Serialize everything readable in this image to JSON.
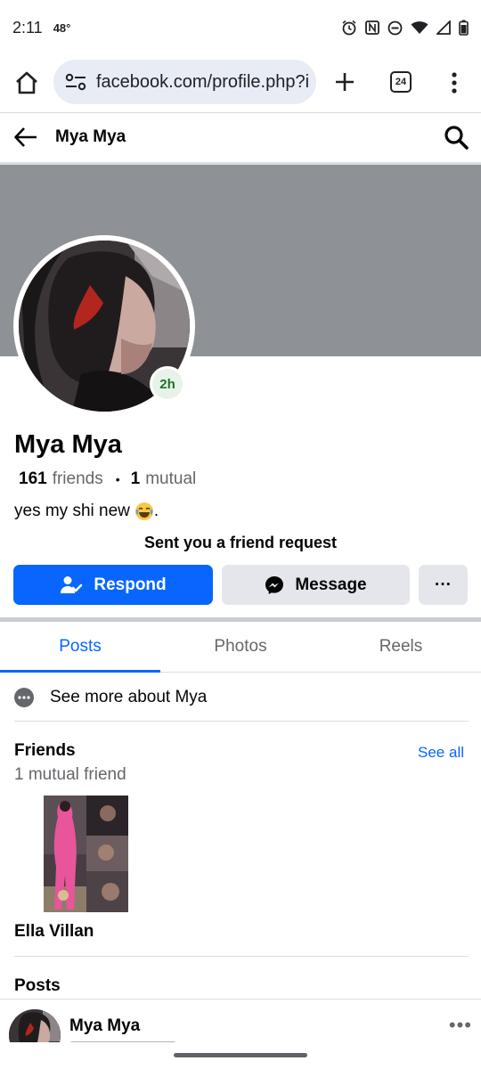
{
  "status_bar": {
    "time": "2:11",
    "temperature": "48°"
  },
  "browser": {
    "url": "facebook.com/profile.php?i",
    "tab_count": "24"
  },
  "header": {
    "title": "Mya Mya"
  },
  "profile": {
    "story_badge": "2h",
    "name": "Mya Mya",
    "friends_count": "161",
    "friends_label": "friends",
    "mutual_count": "1",
    "mutual_label": "mutual",
    "bio": "yes my shi new",
    "bio_suffix": ".",
    "request_note": "Sent you a friend request"
  },
  "actions": {
    "respond_label": "Respond",
    "message_label": "Message",
    "more_label": "···"
  },
  "tabs": [
    {
      "label": "Posts",
      "active": true
    },
    {
      "label": "Photos",
      "active": false
    },
    {
      "label": "Reels",
      "active": false
    }
  ],
  "about": {
    "label": "See more about Mya"
  },
  "friends_section": {
    "title": "Friends",
    "subtitle": "1 mutual friend",
    "see_all": "See all",
    "friend": {
      "name": "Ella Villan"
    }
  },
  "posts_section": {
    "title": "Posts",
    "post_author": "Mya Mya",
    "post_more": "•••"
  },
  "colors": {
    "accent": "#0866ff",
    "cover": "#8e9196",
    "button_secondary": "#e4e6eb"
  }
}
